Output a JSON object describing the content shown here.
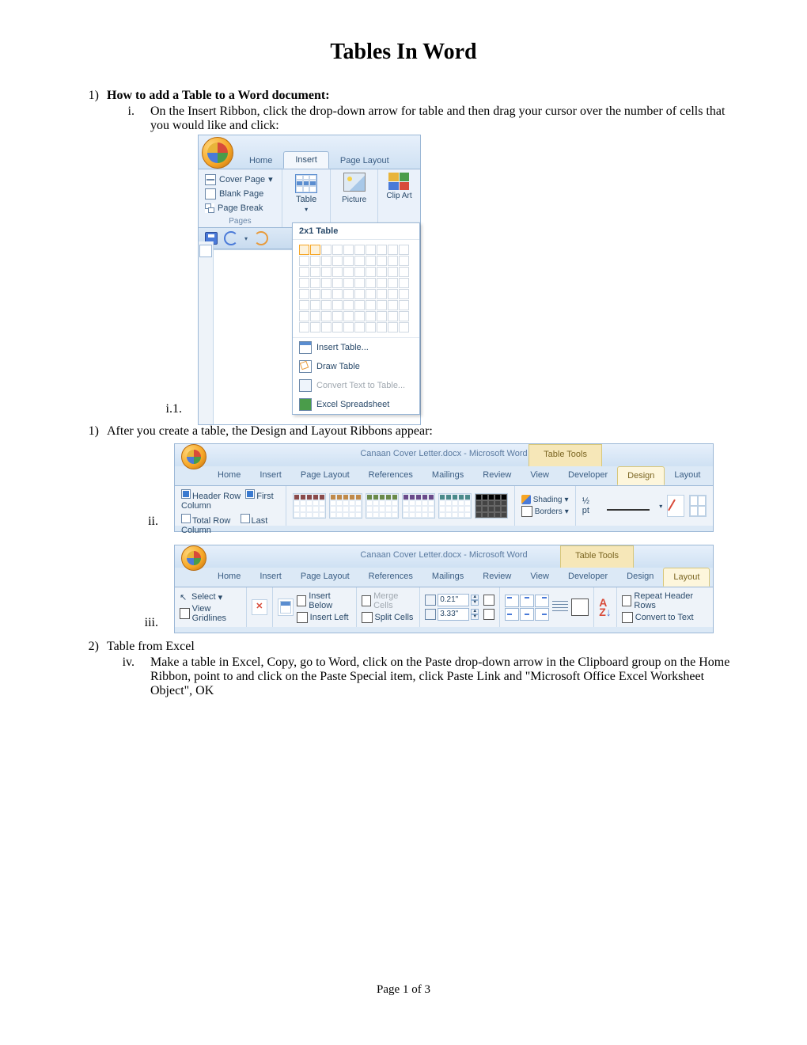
{
  "doc": {
    "title": "Tables In Word",
    "footer": "Page 1 of 3"
  },
  "sections": {
    "s1_num": "1)",
    "s1_heading": "How to add a Table to a Word document:",
    "s1_i_num": "i.",
    "s1_i_text": "On the Insert Ribbon, click the drop-down arrow for table and then drag your cursor over the number of cells that you would like and click:",
    "s1_i1_num": "i.1.",
    "s2_num": "1)",
    "s2_text": "After you create a table, the Design and Layout Ribbons appear:",
    "s2_ii_num": "ii.",
    "s2_iii_num": "iii.",
    "s3_num": "2)",
    "s3_heading": "Table from Excel",
    "s3_iv_num": "iv.",
    "s3_iv_text": "Make a table in Excel, Copy, go to Word, click on the Paste drop-down arrow in the Clipboard group on the Home Ribbon, point to and click on the Paste Special item, click Paste Link and \"Microsoft Office Excel Worksheet Object\", OK"
  },
  "shot1": {
    "tabs": {
      "home": "Home",
      "insert": "Insert",
      "pagelayout": "Page Layout"
    },
    "pages": {
      "cover": "Cover Page",
      "blank": "Blank Page",
      "pgbreak": "Page Break",
      "group": "Pages"
    },
    "table_btn": "Table",
    "picture_btn": "Picture",
    "clipart_btn": "Clip Art",
    "picker_title": "2x1 Table",
    "opts": {
      "insert": "Insert Table...",
      "draw": "Draw Table",
      "convert": "Convert Text to Table...",
      "excel": "Excel Spreadsheet"
    }
  },
  "shot2": {
    "wintitle": "Canaan Cover Letter.docx - Microsoft Word",
    "tooltabs": "Table Tools",
    "tabs": {
      "home": "Home",
      "insert": "Insert",
      "pagelayout": "Page Layout",
      "references": "References",
      "mailings": "Mailings",
      "review": "Review",
      "view": "View",
      "developer": "Developer",
      "design": "Design",
      "layout": "Layout"
    },
    "opts": {
      "headerrow": "Header Row",
      "firstcol": "First Column",
      "totalrow": "Total Row",
      "lastcol": "Last Column",
      "shading": "Shading",
      "borders": "Borders",
      "penwt": "½ pt"
    }
  },
  "shot3": {
    "wintitle": "Canaan Cover Letter.docx - Microsoft Word",
    "tooltabs": "Table Tools",
    "tabs": {
      "home": "Home",
      "insert": "Insert",
      "pagelayout": "Page Layout",
      "references": "References",
      "mailings": "Mailings",
      "review": "Review",
      "view": "View",
      "developer": "Developer",
      "design": "Design",
      "layout": "Layout"
    },
    "btns": {
      "select": "Select",
      "viewgrid": "View Gridlines",
      "insbelow": "Insert Below",
      "insleft": "Insert Left",
      "merge": "Merge Cells",
      "split": "Split Cells",
      "h": "0.21\"",
      "w": "3.33\"",
      "repeat": "Repeat Header Rows",
      "convert": "Convert to Text"
    }
  }
}
